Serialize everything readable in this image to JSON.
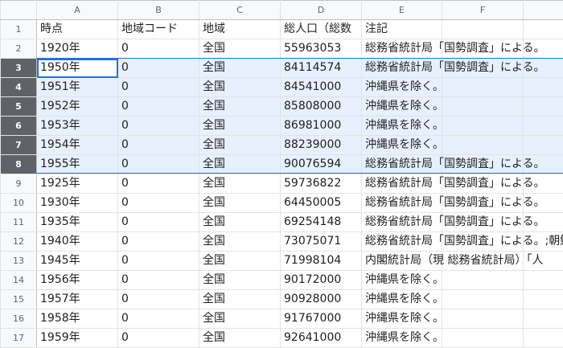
{
  "column_headers": [
    "A",
    "B",
    "C",
    "D",
    "E",
    "F",
    ""
  ],
  "rows": [
    {
      "num": "1",
      "a": "時点",
      "b": "地域コード",
      "c": "地域",
      "d": "総人口（総数",
      "e": "注記"
    },
    {
      "num": "2",
      "a": "1920年",
      "b": "0",
      "c": "全国",
      "d": "55963053",
      "e": "総務省統計局「国勢調査」による。"
    },
    {
      "num": "3",
      "a": "1950年",
      "b": "0",
      "c": "全国",
      "d": "84114574",
      "e": "総務省統計局「国勢調査」による。"
    },
    {
      "num": "4",
      "a": "1951年",
      "b": "0",
      "c": "全国",
      "d": "84541000",
      "e": "沖縄県を除く。"
    },
    {
      "num": "5",
      "a": "1952年",
      "b": "0",
      "c": "全国",
      "d": "85808000",
      "e": "沖縄県を除く。"
    },
    {
      "num": "6",
      "a": "1953年",
      "b": "0",
      "c": "全国",
      "d": "86981000",
      "e": "沖縄県を除く。"
    },
    {
      "num": "7",
      "a": "1954年",
      "b": "0",
      "c": "全国",
      "d": "88239000",
      "e": "沖縄県を除く。"
    },
    {
      "num": "8",
      "a": "1955年",
      "b": "0",
      "c": "全国",
      "d": "90076594",
      "e": "総務省統計局「国勢調査」による。"
    },
    {
      "num": "9",
      "a": "1925年",
      "b": "0",
      "c": "全国",
      "d": "59736822",
      "e": "総務省統計局「国勢調査」による。"
    },
    {
      "num": "10",
      "a": "1930年",
      "b": "0",
      "c": "全国",
      "d": "64450005",
      "e": "総務省統計局「国勢調査」による。"
    },
    {
      "num": "11",
      "a": "1935年",
      "b": "0",
      "c": "全国",
      "d": "69254148",
      "e": "総務省統計局「国勢調査」による。"
    },
    {
      "num": "12",
      "a": "1940年",
      "b": "0",
      "c": "全国",
      "d": "73075071",
      "e": "総務省統計局「国勢調査」による。;朝鮮"
    },
    {
      "num": "13",
      "a": "1945年",
      "b": "0",
      "c": "全国",
      "d": "71998104",
      "e": "内閣統計局（現 総務省統計局）「人"
    },
    {
      "num": "14",
      "a": "1956年",
      "b": "0",
      "c": "全国",
      "d": "90172000",
      "e": "沖縄県を除く。"
    },
    {
      "num": "15",
      "a": "1957年",
      "b": "0",
      "c": "全国",
      "d": "90928000",
      "e": "沖縄県を除く。"
    },
    {
      "num": "16",
      "a": "1958年",
      "b": "0",
      "c": "全国",
      "d": "91767000",
      "e": "沖縄県を除く。"
    },
    {
      "num": "17",
      "a": "1959年",
      "b": "0",
      "c": "全国",
      "d": "92641000",
      "e": "沖縄県を除く。"
    }
  ],
  "selection": {
    "rows": [
      "3",
      "4",
      "5",
      "6",
      "7",
      "8"
    ],
    "active_cell": "A3"
  },
  "colors": {
    "selection_fill": "#e8f0fe",
    "selection_border": "#1a73e8",
    "selected_header": "#5f6368"
  }
}
